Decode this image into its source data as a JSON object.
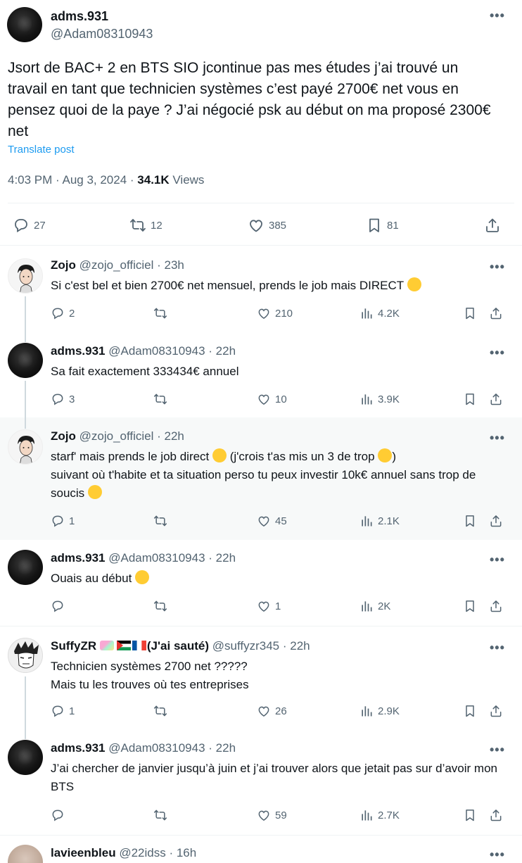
{
  "main_post": {
    "name": "adms.931",
    "handle": "@Adam08310943",
    "text": "Jsort de BAC+ 2 en BTS SIO jcontinue pas mes études j’ai trouvé un travail en tant que technicien systèmes c’est payé 2700€ net vous en pensez quoi de la paye ? J’ai négocié psk au début on ma proposé 2300€ net",
    "translate": "Translate post",
    "time": "4:03 PM · Aug 3, 2024 · ",
    "views_count": "34.1K",
    "views_label": " Views",
    "replies": "27",
    "reposts": "12",
    "likes": "385",
    "bookmarks": "81"
  },
  "replies": [
    {
      "name": "Zojo",
      "handle": "@zojo_officiel",
      "time": " · 23h",
      "text": "Si c'est bel et bien 2700€ net mensuel, prends le job mais DIRECT",
      "replies": "2",
      "reposts": "",
      "likes": "210",
      "views": "4.2K",
      "avatar": "cartoon"
    },
    {
      "name": "adms.931",
      "handle": "@Adam08310943",
      "time": " · 22h",
      "text": "Sa fait exactement 333434€ annuel",
      "replies": "3",
      "reposts": "",
      "likes": "10",
      "views": "3.9K",
      "avatar": "dark"
    },
    {
      "name": "Zojo",
      "handle": "@zojo_officiel",
      "time": " · 22h",
      "text_parts": [
        "starf' mais prends le job direct ",
        " (j'crois t'as mis un 3 de trop ",
        ")",
        "suivant où t'habite et ta situation perso tu peux investir 10k€ annuel sans trop de soucis "
      ],
      "replies": "1",
      "reposts": "",
      "likes": "45",
      "views": "2.1K",
      "avatar": "cartoon"
    },
    {
      "name": "adms.931",
      "handle": "@Adam08310943",
      "time": " · 22h",
      "text": "Ouais au début ",
      "replies": "",
      "reposts": "",
      "likes": "1",
      "views": "2K",
      "avatar": "dark"
    },
    {
      "name_prefix": "SuffyZR ",
      "name_suffix": "(J'ai sauté)",
      "handle": " @suffyzr345",
      "time": " · 22h",
      "line1": "Technicien systèmes 2700 net ?????",
      "line2": "Mais tu les trouves où tes entreprises",
      "replies": "1",
      "reposts": "",
      "likes": "26",
      "views": "2.9K",
      "avatar": "manga"
    },
    {
      "name": "adms.931",
      "handle": "@Adam08310943",
      "time": " · 22h",
      "text": "J’ai chercher de janvier jusqu’à juin et j’ai trouver alors que jetait pas sur d’avoir mon BTS",
      "replies": "",
      "reposts": "",
      "likes": "59",
      "views": "2.7K",
      "avatar": "dark"
    },
    {
      "name": "lavieenbleu",
      "handle": "@22idss",
      "time": " · 16h",
      "avatar": "photo"
    }
  ],
  "colors": {
    "text": "#0f1419",
    "secondary": "#536471",
    "link": "#1d9bf0",
    "divider": "#eff3f4",
    "thread_line": "#cfd9de",
    "highlight_bg": "#f7f9f9"
  }
}
